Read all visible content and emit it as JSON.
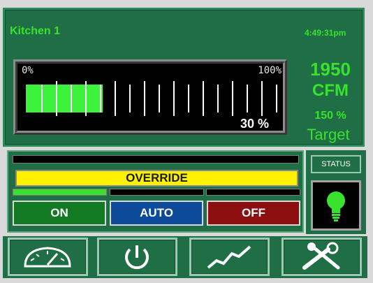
{
  "header": {
    "title": "Kitchen 1",
    "time": "4:49:31pm"
  },
  "gauge": {
    "min_label": "0%",
    "max_label": "100%",
    "value_label": "30 %",
    "fill_fraction": 0.3
  },
  "readout": {
    "airflow": "1950",
    "unit": "CFM",
    "percent": "150 %",
    "target_label": "Target"
  },
  "controls": {
    "override_label": "OVERRIDE",
    "on_label": "ON",
    "auto_label": "AUTO",
    "off_label": "OFF",
    "status_label": "STATUS"
  },
  "colors": {
    "panel": "#1f6e45",
    "accent_green": "#39e22c",
    "override_yellow": "#fff200",
    "on_green": "#127a22",
    "auto_blue": "#0e4a9a",
    "off_red": "#8e0f10"
  },
  "nav": [
    {
      "icon": "speedometer-icon"
    },
    {
      "icon": "power-icon"
    },
    {
      "icon": "trend-chart-icon"
    },
    {
      "icon": "tools-icon"
    }
  ]
}
